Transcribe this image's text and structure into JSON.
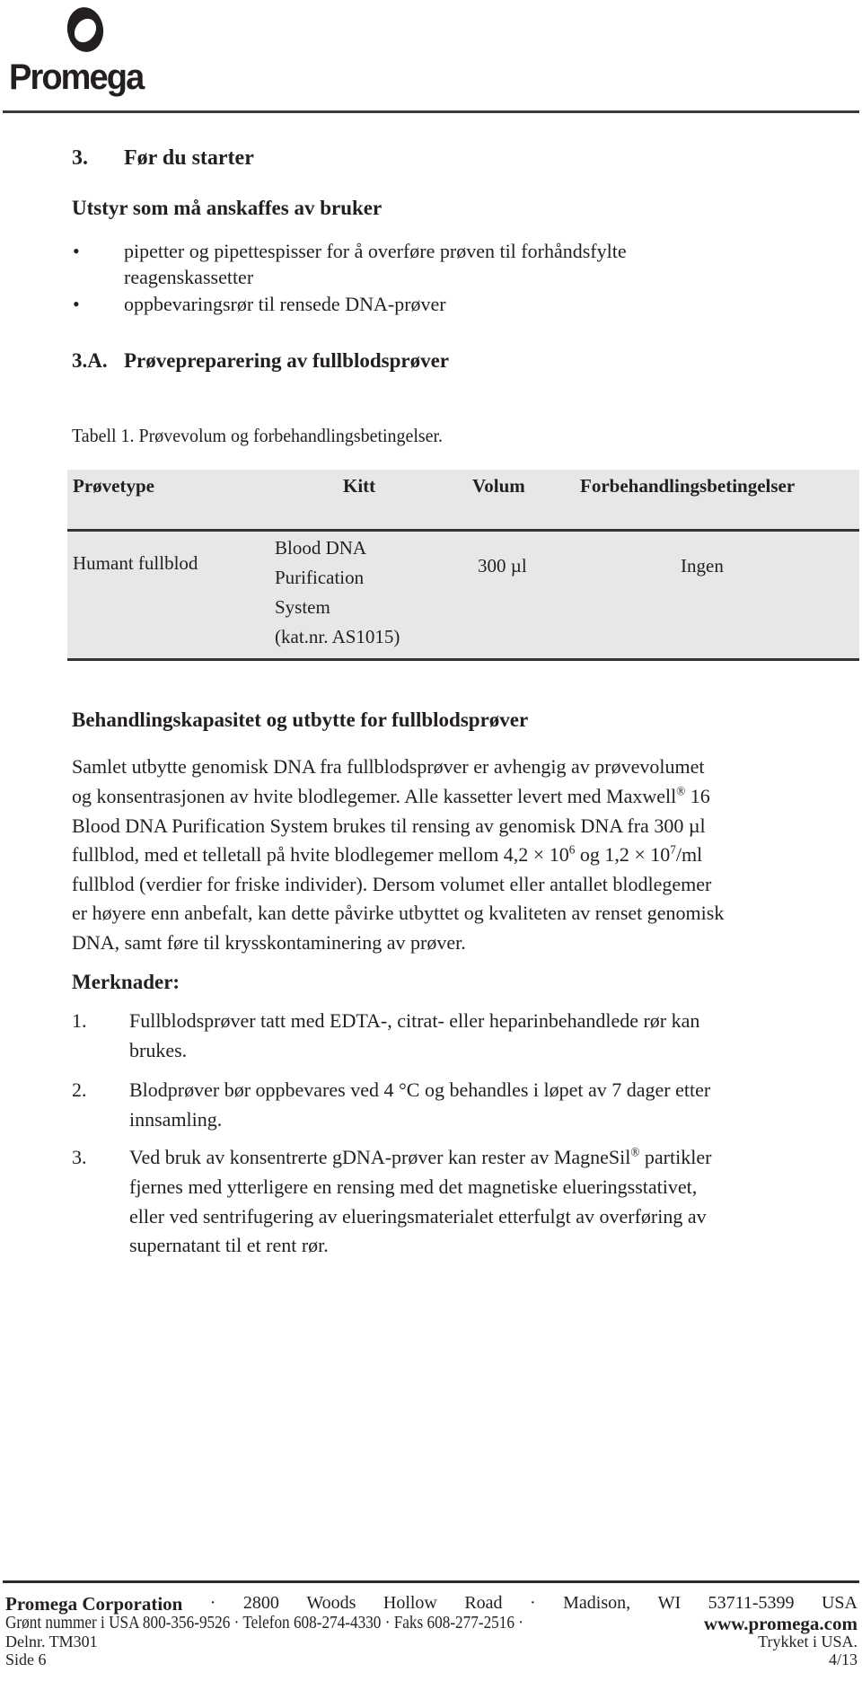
{
  "header": {
    "logo_text": "Promega",
    "logo_icon": "promega-logo-mark"
  },
  "section": {
    "number": "3.",
    "title": "Før du starter"
  },
  "equipment": {
    "heading": "Utstyr som må anskaffes av bruker",
    "bullet": "•",
    "items": [
      {
        "line1": "pipetter og pipettespisser for å overføre prøven til forhåndsfylte",
        "line2": "reagenskassetter"
      },
      {
        "line1": "oppbevaringsrør til rensede DNA-prøver"
      }
    ]
  },
  "subsection": {
    "number": "3.A.",
    "title": "Prøvepreparering av fullblodsprøver"
  },
  "table": {
    "caption": "Tabell 1. Prøvevolum og forbehandlingsbetingelser.",
    "headers": [
      "Prøvetype",
      "Kitt",
      "Volum",
      "Forbehandlingsbetingelser"
    ],
    "rows": [
      {
        "sample_type": "Humant fullblod",
        "kit_lines": [
          "Blood DNA",
          "Purification",
          "System",
          "(kat.nr. AS1015)"
        ],
        "volume": "300 µl",
        "pretreatment": "Ingen"
      }
    ]
  },
  "capacity": {
    "heading": "Behandlingskapasitet og utbytte for fullblodsprøver",
    "lines": [
      "Samlet utbytte genomisk DNA fra fullblodsprøver er avhengig av prøvevolumet",
      {
        "pre": "og konsentrasjonen av hvite blodlegemer. Alle kassetter levert med Maxwell",
        "sup": "®",
        "post": " 16"
      },
      "Blood DNA Purification System brukes til rensing av genomisk DNA fra 300 µl",
      {
        "pre": "fullblod, med et telletall på hvite blodlegemer mellom 4,2 × 10",
        "sup": "6",
        "mid": " og 1,2 × 10",
        "sup2": "7",
        "post": "/ml"
      },
      "fullblod (verdier for friske individer). Dersom volumet eller antallet blodlegemer",
      "er høyere enn anbefalt, kan dette påvirke utbyttet og kvaliteten av renset genomisk",
      "DNA, samt føre til krysskontaminering av prøver."
    ]
  },
  "notes": {
    "heading": "Merknader:",
    "items": [
      {
        "num": "1.",
        "lines": [
          "Fullblodsprøver tatt med EDTA-, citrat- eller heparinbehandlede rør kan",
          "brukes."
        ]
      },
      {
        "num": "2.",
        "lines": [
          "Blodprøver bør oppbevares ved 4 °C og behandles i løpet av 7 dager etter",
          "innsamling."
        ]
      },
      {
        "num": "3.",
        "line1_pre": "Ved bruk av konsentrerte gDNA-prøver kan rester av MagneSil",
        "line1_sup": "®",
        "line1_post": " partikler",
        "lines": [
          "",
          "fjernes med ytterligere en rensing med det magnetiske elueringsstativet,",
          "eller ved sentrifugering av elueringsmaterialet etterfulgt av overføring av",
          "supernatant til et rent rør."
        ]
      }
    ]
  },
  "footer": {
    "company": "Promega Corporation",
    "address_parts": [
      "·",
      "2800",
      "Woods",
      "Hollow",
      "Road",
      "·",
      "Madison,",
      "WI",
      "53711-5399",
      "USA"
    ],
    "contact": "Grønt nummer i USA 800-356-9526 · Telefon 608-274-4330 · Faks 608-277-2516 ·",
    "website": "www.promega.com",
    "part_number": "Delnr. TM301",
    "printed": "Trykket i USA.",
    "page": "Side 6",
    "revision": "4/13"
  }
}
